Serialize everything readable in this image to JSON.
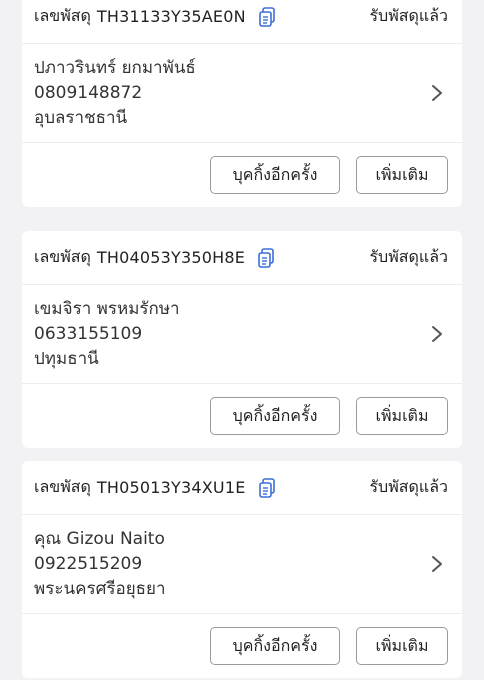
{
  "shipments": [
    {
      "tracking_label": "เลขพัสดุ",
      "tracking_number": "TH31133Y35AE0N",
      "status": "รับพัสดุแล้ว",
      "recipient_name": "ปภาวรินทร์ ยกมาพันธ์",
      "phone": "0809148872",
      "province": "อุบลราชธานี",
      "rebook_label": "บุคกิ้งอีกครั้ง",
      "more_label": "เพิ่มเติม"
    },
    {
      "tracking_label": "เลขพัสดุ",
      "tracking_number": "TH04053Y350H8E",
      "status": "รับพัสดุแล้ว",
      "recipient_name": "เขมจิรา พรหมรักษา",
      "phone": "0633155109",
      "province": "ปทุมธานี",
      "rebook_label": "บุคกิ้งอีกครั้ง",
      "more_label": "เพิ่มเติม"
    },
    {
      "tracking_label": "เลขพัสดุ",
      "tracking_number": "TH05013Y34XU1E",
      "status": "รับพัสดุแล้ว",
      "recipient_name": "คุณ Gizou Naito",
      "phone": "0922515209",
      "province": "พระนครศรีอยุธยา",
      "rebook_label": "บุคกิ้งอีกครั้ง",
      "more_label": "เพิ่มเติม"
    }
  ],
  "colors": {
    "background": "#f2f2f4",
    "card": "#ffffff",
    "copy_icon": "#3b6fd8",
    "chevron": "#555555",
    "button_border": "#9a9a9a"
  },
  "icons": {
    "copy": "copy-icon",
    "chevron": "chevron-right-icon"
  }
}
